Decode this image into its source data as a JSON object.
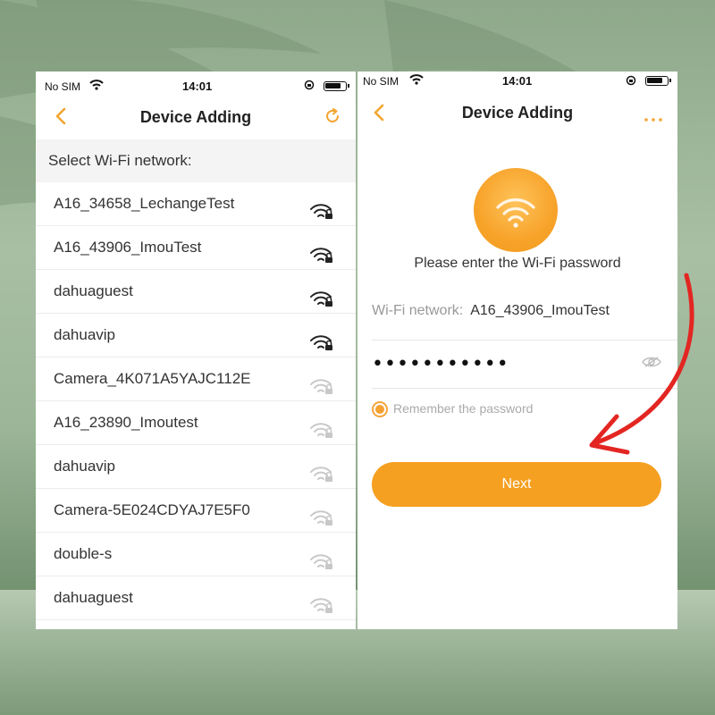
{
  "colors": {
    "accent": "#f5a020",
    "arrow": "#e32622",
    "background": "#9cb598"
  },
  "left": {
    "status": {
      "carrier": "No SIM",
      "time": "14:01"
    },
    "nav": {
      "title": "Device Adding",
      "back_icon": "chevron-left-icon",
      "right_icon": "refresh-icon"
    },
    "section_header": "Select Wi-Fi network:",
    "networks": [
      {
        "name": "A16_34658_LechangeTest",
        "strength": "strong",
        "locked": true
      },
      {
        "name": "A16_43906_ImouTest",
        "strength": "strong",
        "locked": true
      },
      {
        "name": "dahuaguest",
        "strength": "strong",
        "locked": true
      },
      {
        "name": "dahuavip",
        "strength": "strong",
        "locked": true
      },
      {
        "name": "Camera_4K071A5YAJC112E",
        "strength": "weak",
        "locked": true
      },
      {
        "name": "A16_23890_Imoutest",
        "strength": "weak",
        "locked": true
      },
      {
        "name": "dahuavip",
        "strength": "weak",
        "locked": true
      },
      {
        "name": "Camera-5E024CDYAJ7E5F0",
        "strength": "weak",
        "locked": true
      },
      {
        "name": "double-s",
        "strength": "weak",
        "locked": true
      },
      {
        "name": "dahuaguest",
        "strength": "weak",
        "locked": true
      }
    ]
  },
  "right": {
    "status": {
      "carrier": "No SIM",
      "time": "14:01"
    },
    "nav": {
      "title": "Device Adding",
      "back_icon": "chevron-left-icon",
      "right_icon": "more-icon"
    },
    "prompt": "Please enter the Wi-Fi password",
    "network_label": "Wi-Fi network:",
    "network_value": "A16_43906_ImouTest",
    "password_masked": "•••••••••••",
    "remember_label": "Remember the password",
    "remember_checked": true,
    "next_label": "Next"
  }
}
